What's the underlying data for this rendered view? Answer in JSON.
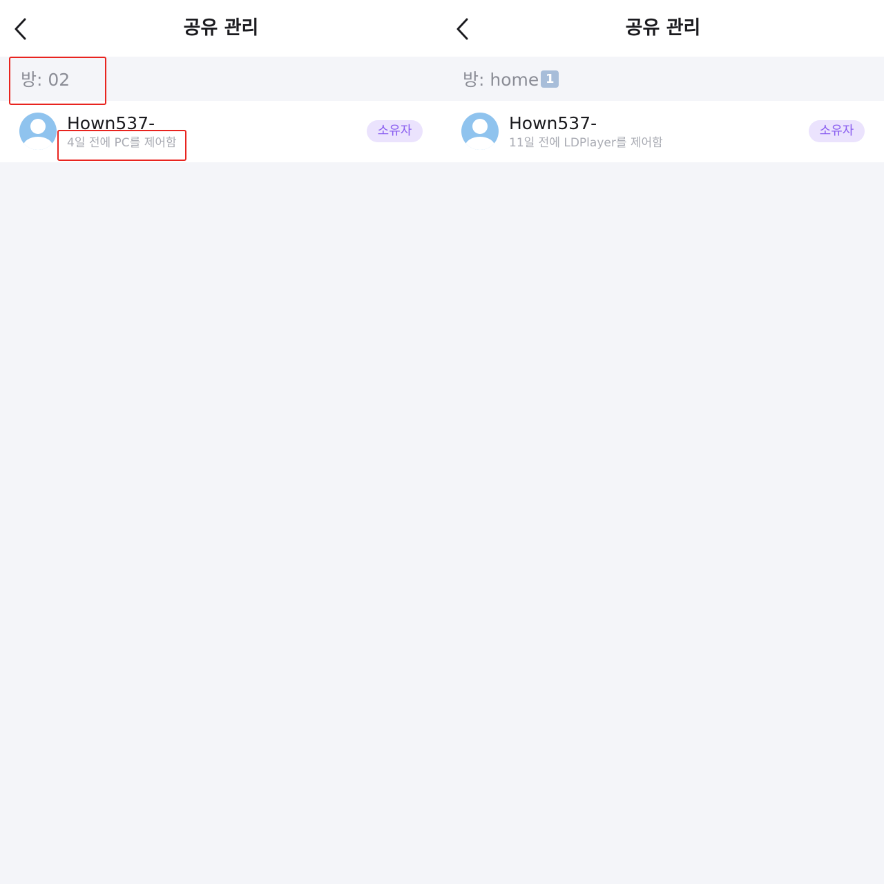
{
  "panels": [
    {
      "title": "공유 관리",
      "room": {
        "label": "방: 02",
        "badge": ""
      },
      "member": {
        "name": "Hown537-",
        "subtitle": "4일 전에 PC를 제어함",
        "role": "소유자"
      }
    },
    {
      "title": "공유 관리",
      "room": {
        "label": "방: home",
        "badge": "1"
      },
      "member": {
        "name": "Hown537-",
        "subtitle": "11일 전에 LDPlayer를 제어함",
        "role": "소유자"
      }
    }
  ],
  "icons": {
    "back": "chevron-left-icon",
    "avatar": "user-avatar-icon"
  },
  "colors": {
    "background": "#f4f5f9",
    "title_text": "#1b1b1f",
    "secondary_text": "#a9abb3",
    "role_badge_bg": "#ebe3fd",
    "role_badge_text": "#8a5ef0",
    "room_count_badge": "#a7bdd9",
    "annotation_box": "#e8241f"
  }
}
